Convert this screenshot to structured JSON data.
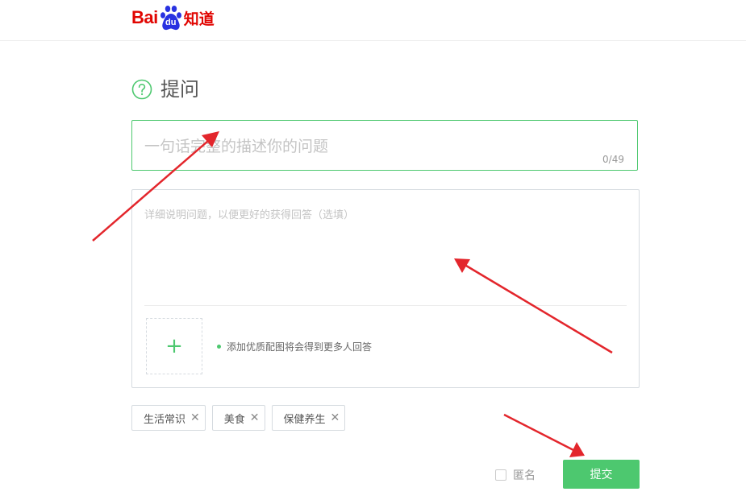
{
  "header": {
    "logo": {
      "brand": "Bai",
      "paw_text": "du",
      "product": "知道"
    }
  },
  "page": {
    "title": "提问",
    "title_icon": "question-circle-icon"
  },
  "question": {
    "placeholder": "一句话完整的描述你的问题",
    "value": "",
    "counter": "0/49"
  },
  "details": {
    "placeholder": "详细说明问题，以便更好的获得回答（选填）",
    "value": "",
    "upload_icon": "plus-icon",
    "upload_hint": "添加优质配图将会得到更多人回答"
  },
  "tags": [
    {
      "label": "生活常识",
      "remove_icon": "close-icon"
    },
    {
      "label": "美食",
      "remove_icon": "close-icon"
    },
    {
      "label": "保健养生",
      "remove_icon": "close-icon"
    }
  ],
  "footer": {
    "anonymous_label": "匿名",
    "anonymous_checked": false,
    "submit_label": "提交"
  },
  "colors": {
    "brand_red": "#e10602",
    "brand_blue": "#2932e1",
    "accent_green": "#4dc86f",
    "annotation_red": "#e3262c"
  }
}
